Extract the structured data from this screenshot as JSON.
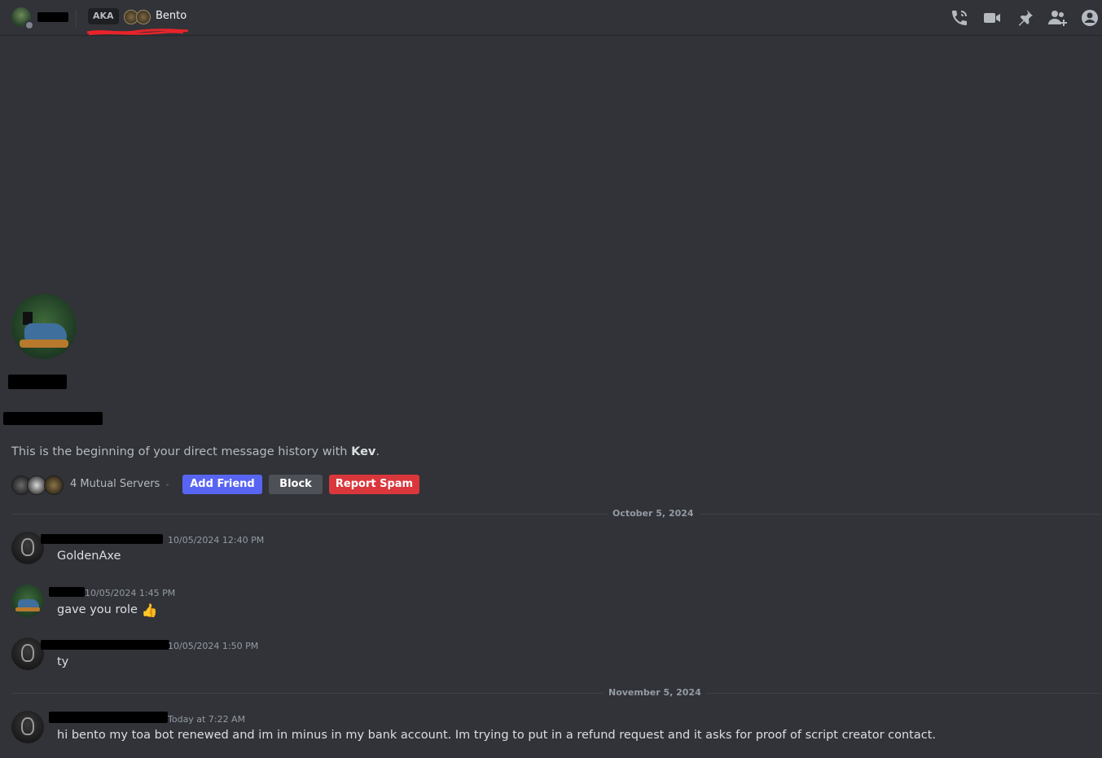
{
  "header": {
    "aka_label": "AKA",
    "aka_name": "Bento",
    "toolbar": [
      "voice-call-icon",
      "video-call-icon",
      "pin-icon",
      "add-friends-to-dm-icon",
      "user-profile-icon"
    ],
    "icon_color": "#b5bac1",
    "scribble_color": "#e8242a"
  },
  "intro": {
    "text_prefix": "This is the beginning of your direct message history with ",
    "name": "Kev",
    "text_suffix": "."
  },
  "mutual": {
    "label": "4 Mutual Servers",
    "buttons": {
      "add_friend": "Add Friend",
      "block": "Block",
      "report_spam": "Report Spam"
    },
    "colors": {
      "add_friend": "#5865f2",
      "block": "#4e5058",
      "report_spam": "#da373c"
    }
  },
  "dividers": [
    "October 5, 2024",
    "November 5, 2024"
  ],
  "messages": [
    {
      "timestamp": "10/05/2024 12:40 PM",
      "text": "GoldenAxe",
      "avatar": "mask"
    },
    {
      "timestamp": "10/05/2024 1:45 PM",
      "text": "gave you role",
      "emoji": "👍",
      "avatar": "turtle"
    },
    {
      "timestamp": "10/05/2024 1:50 PM",
      "text": "ty",
      "avatar": "mask"
    },
    {
      "timestamp": "Today at 7:22 AM",
      "text": "hi bento my toa bot renewed and im in minus in my bank account. Im trying to put in a refund request and it asks for proof of script creator contact.",
      "avatar": "mask"
    }
  ],
  "theme": {
    "background": "#313338",
    "text": "#dbdee1",
    "muted": "#949ba4"
  }
}
